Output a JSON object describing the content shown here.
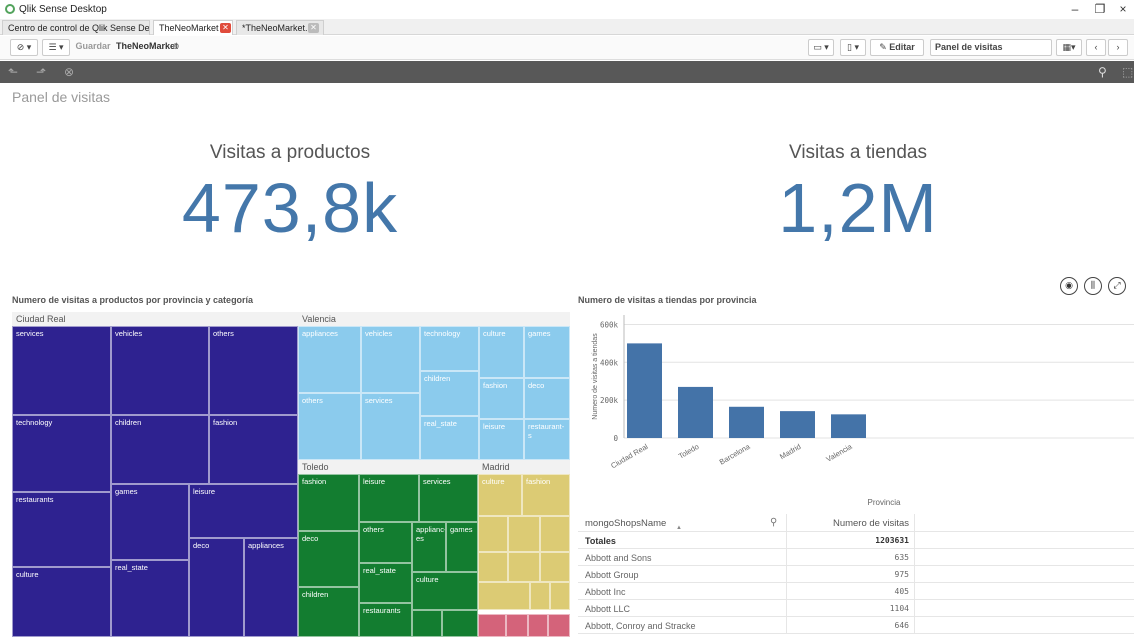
{
  "window": {
    "title": "Qlik Sense Desktop",
    "minimize": "–",
    "restore": "❐",
    "close": "×"
  },
  "tabs": [
    {
      "label": "Centro de control de Qlik Sense Desktop"
    },
    {
      "label": "TheNeoMarket -..."
    },
    {
      "label": "*TheNeoMarket..."
    }
  ],
  "toolbar": {
    "save_label": "Guardar",
    "app_name": "TheNeoMarket",
    "edit_label": "Editar",
    "sheet_selector": "Panel de visitas"
  },
  "sheet": {
    "title": "Panel de visitas"
  },
  "kpis": [
    {
      "label": "Visitas a productos",
      "value": "473,8k"
    },
    {
      "label": "Visitas a tiendas",
      "value": "1,2M"
    }
  ],
  "treemap": {
    "title": "Numero de visitas a productos por provincia y categoría",
    "groups": [
      {
        "name": "Ciudad Real",
        "color": "#2e2290",
        "cells": [
          "services",
          "vehicles",
          "others",
          "technology",
          "children",
          "fashion",
          "restaurants",
          "games",
          "leisure",
          "deco",
          "appliances",
          "culture",
          "real_state"
        ]
      },
      {
        "name": "Valencia",
        "color": "#8bcbed",
        "cells": [
          "appliances",
          "vehicles",
          "technology",
          "culture",
          "games",
          "others",
          "services",
          "children",
          "fashion",
          "deco",
          "real_state",
          "leisure",
          "restaurant-s"
        ]
      },
      {
        "name": "Toledo",
        "color": "#137d30",
        "cells": [
          "fashion",
          "leisure",
          "services",
          "deco",
          "others",
          "applianc-es",
          "games",
          "real_state",
          "culture",
          "children",
          "restaurants"
        ]
      },
      {
        "name": "Madrid",
        "color": "#dccb74",
        "cells": [
          "culture",
          "fashion"
        ]
      }
    ]
  },
  "bar_chart": {
    "title": "Numero de visitas a tiendas por provincia",
    "ylabel": "Numero de visitas a tiendas",
    "xlabel": "Provincia",
    "yticks": [
      "0",
      "200k",
      "400k",
      "600k"
    ]
  },
  "chart_data": {
    "type": "bar",
    "categories": [
      "Ciudad Real",
      "Toledo",
      "Barcelona",
      "Madrid",
      "Valencia"
    ],
    "values": [
      500000,
      270000,
      165000,
      142000,
      125000
    ],
    "ylim": [
      0,
      650000
    ],
    "color": "#4473a8"
  },
  "table": {
    "columns": [
      "mongoShopsName",
      "Numero de visitas"
    ],
    "totals": {
      "label": "Totales",
      "value": "1203631"
    },
    "rows": [
      {
        "name": "Abbott and Sons",
        "value": "635"
      },
      {
        "name": "Abbott Group",
        "value": "975"
      },
      {
        "name": "Abbott Inc",
        "value": "405"
      },
      {
        "name": "Abbott LLC",
        "value": "1104"
      },
      {
        "name": "Abbott, Conroy and Stracke",
        "value": "646"
      }
    ]
  }
}
